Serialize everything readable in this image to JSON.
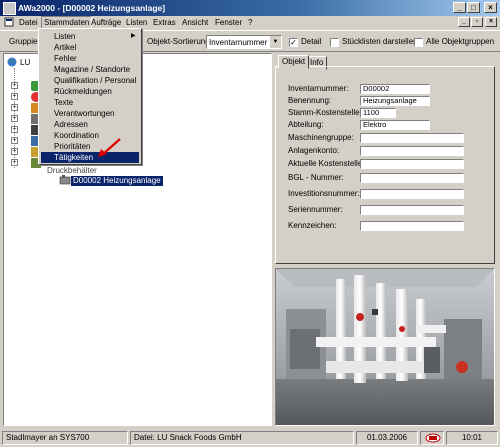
{
  "window": {
    "title": "AWa2000 - [D00002 Heizungsanlage]"
  },
  "menu": {
    "items": [
      "Datei",
      "Stammdaten",
      "Aufträge",
      "Listen",
      "Extras",
      "Ansicht",
      "Fenster",
      "?"
    ]
  },
  "toolbar": {
    "grouping_label": "Gruppieru",
    "sort_label": "Objekt-Sortierung",
    "sort_value": "Inventarnummer",
    "detail_label": "Detail",
    "detail_checked": true,
    "stueckliste_label": "Stücklisten darstellen",
    "stueckliste_checked": false,
    "alle_gruppen_label": "Alle Objektgruppen",
    "alle_gruppen_checked": false
  },
  "dropdown": {
    "items": [
      "Listen",
      "Artikel",
      "Fehler",
      "Magazine / Standorte",
      "Qualifikation / Personal",
      "Rückmeldungen",
      "Texte",
      "Verantwortungen",
      "Adressen",
      "Koordination",
      "Prioritäten",
      "Tätigkeiten"
    ],
    "highlighted": "Tätigkeiten"
  },
  "tree": {
    "root_label": "LU",
    "partial_node": "Druckbehälter",
    "selected_node": "D00002 Heizungsanlage"
  },
  "tabs": [
    "Objekt",
    "Info"
  ],
  "form": {
    "fields": [
      {
        "label": "Inventarnummer:",
        "value": "D00002"
      },
      {
        "label": "Benennung:",
        "value": "Heizungsanlage"
      },
      {
        "label": "Stamm-Kostenstelle:",
        "value": "1100"
      },
      {
        "label": "Abteilung:",
        "value": "Elektro"
      },
      {
        "label": "Maschinengruppe:",
        "value": ""
      },
      {
        "label": "Anlagenkonto:",
        "value": ""
      },
      {
        "label": "Aktuelle Kostenstelle:",
        "value": ""
      },
      {
        "label": "BGL - Nummer:",
        "value": ""
      },
      {
        "label": "Investitionsnummer:",
        "value": ""
      },
      {
        "label": "Seriennummer:",
        "value": ""
      },
      {
        "label": "Kennzeichen:",
        "value": ""
      }
    ]
  },
  "status": {
    "user": "Stadlmayer an SYS700",
    "database": "Datei: LU Snack Foods GmbH",
    "date": "01.03.2006",
    "time": "10:01"
  }
}
